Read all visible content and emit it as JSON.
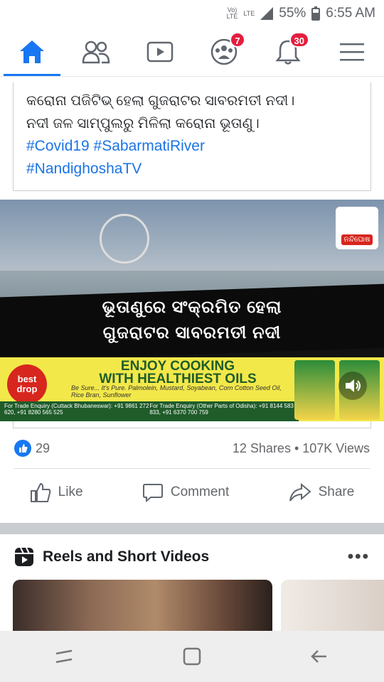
{
  "status_bar": {
    "volte": "Vo) LTE",
    "lte": "LTE",
    "battery": "55%",
    "time": "6:55 AM"
  },
  "nav": {
    "tabs": [
      {
        "name": "home",
        "icon": "home-icon"
      },
      {
        "name": "friends",
        "icon": "friends-icon"
      },
      {
        "name": "watch",
        "icon": "video-icon"
      },
      {
        "name": "groups",
        "icon": "groups-icon",
        "badge": "7"
      },
      {
        "name": "notifications",
        "icon": "bell-icon",
        "badge": "30"
      },
      {
        "name": "menu",
        "icon": "menu-icon"
      }
    ]
  },
  "post": {
    "text_line1": "କରୋନା ପଜିଟିଭ୍ ହେଲା ଗୁଜରାଟର ସାବରମତୀ ନଦୀ।",
    "text_line2": "ନଦୀ ଜଳ ସାମ୍ପୁଲରୁ ମିଳିଲା କରୋନା ଭୂତାଣୁ।",
    "hashtags_line1": "#Covid19 #SabarmatiRiver",
    "hashtags_line2": "#NandighoshaTV",
    "video": {
      "channel_logo": "ନନ୍ଦିଘୋଷ",
      "headline1": "ଭୂତାଣୁରେ ସଂକ୍ରମିତ ହେଲା",
      "headline2": "ଗୁଜରାଟର ସାବରମତୀ ନଦୀ",
      "ad": {
        "brand": "best drop",
        "title1": "ENJOY COOKING",
        "title2": "WITH HEALTHIEST OILS",
        "tagline": "Be Sure... It's Pure.",
        "oils": "Palmolein, Mustard, Soyabean, Corn Cotton Seed Oil, Rice Bran, Sunflower",
        "contact_left": "For Trade Enquiry (Cuttack Bhubaneswar): +91 9861 272 620, +91 8280 565 525",
        "contact_right": "For Trade Enquiry (Other Parts of Odisha): +91 8144 583 833, +91 6370 700 759"
      }
    },
    "likes": "29",
    "shares": "12 Shares",
    "views": "107K Views",
    "actions": {
      "like": "Like",
      "comment": "Comment",
      "share": "Share"
    }
  },
  "reels": {
    "title": "Reels and Short Videos",
    "more": "•••"
  },
  "colors": {
    "accent": "#1877f2",
    "badge": "#e41e3f"
  }
}
